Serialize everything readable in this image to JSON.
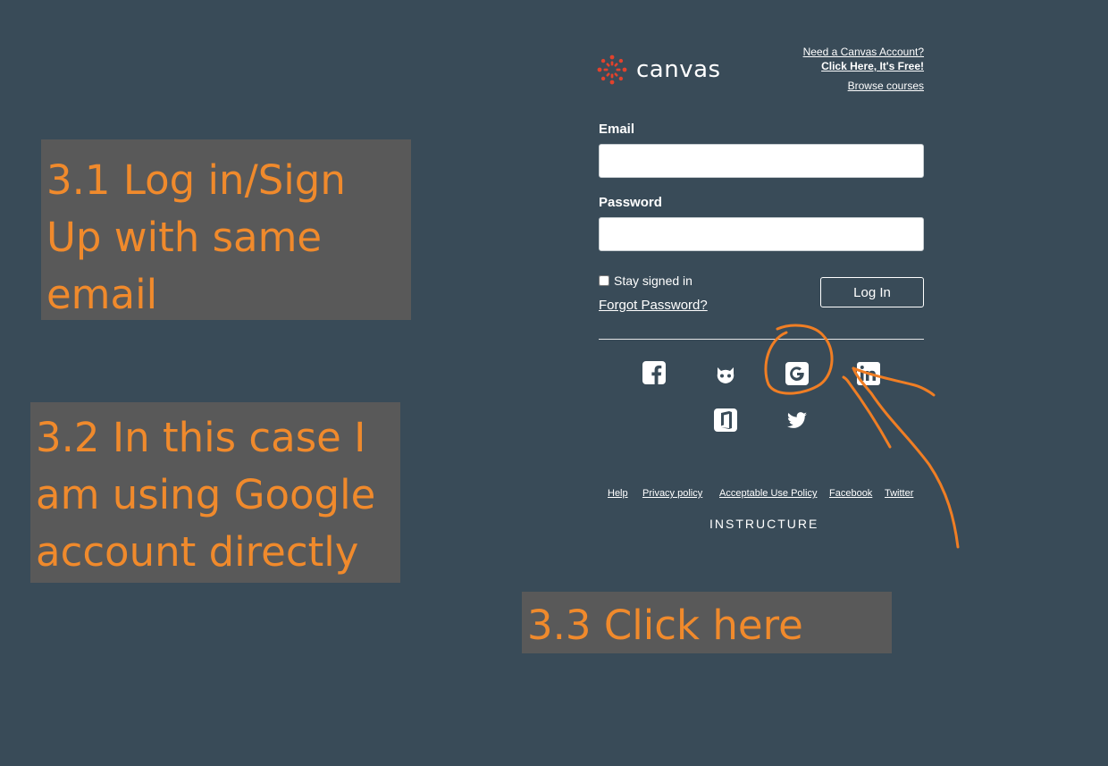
{
  "notes": {
    "step1": "3.1  Log in/Sign Up with same email",
    "step2": "3.2  In this case I am using Google account directly",
    "step3": "3.3  Click here"
  },
  "brand": {
    "name": "canvas",
    "accent": "#e2422c"
  },
  "header_links": {
    "need_account": "Need a Canvas Account?",
    "click_here": "Click Here, It's Free!",
    "browse": "Browse courses"
  },
  "form": {
    "email_label": "Email",
    "email_value": "",
    "password_label": "Password",
    "password_value": "",
    "stay_signed_in": "Stay signed in",
    "forgot_password": "Forgot Password?",
    "login_button": "Log In"
  },
  "social_icons": [
    "facebook-icon",
    "github-icon",
    "google-icon",
    "linkedin-icon",
    "office365-icon",
    "twitter-icon"
  ],
  "footer": {
    "links": [
      "Help",
      "Privacy policy",
      "Acceptable Use Policy",
      "Facebook",
      "Twitter"
    ],
    "company": "INSTRUCTURE"
  },
  "colors": {
    "background": "#394b58",
    "note_bg": "#595959",
    "note_text": "#f08a2c",
    "annotation": "#f07e24"
  }
}
